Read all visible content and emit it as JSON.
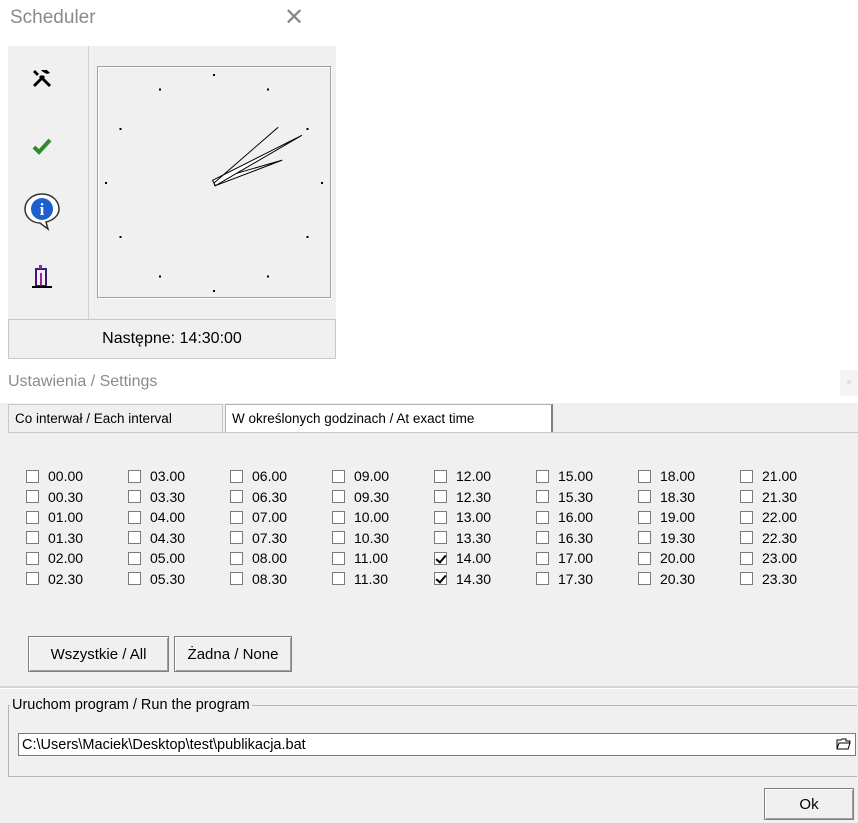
{
  "scheduler": {
    "title": "Scheduler",
    "close_glyph": "✕",
    "toolbar": [
      {
        "name": "settings-tools-icon",
        "glyph": "⚒"
      },
      {
        "name": "checkmark-icon",
        "glyph": "✔"
      },
      {
        "name": "info-icon",
        "glyph": "i"
      },
      {
        "name": "exit-door-icon",
        "glyph": "⍐"
      }
    ],
    "clock": {
      "hour": 2,
      "minute": 7,
      "second": 4
    },
    "status_text": "Następne: 14:30:00"
  },
  "settings": {
    "title": "Ustawienia / Settings",
    "tabs": [
      {
        "label": "Co interwał / Each interval",
        "active": false
      },
      {
        "label": "W określonych godzinach / At exact time",
        "active": true
      }
    ],
    "times": [
      [
        "00.00",
        "00.30",
        "01.00",
        "01.30",
        "02.00",
        "02.30"
      ],
      [
        "03.00",
        "03.30",
        "04.00",
        "04.30",
        "05.00",
        "05.30"
      ],
      [
        "06.00",
        "06.30",
        "07.00",
        "07.30",
        "08.00",
        "08.30"
      ],
      [
        "09.00",
        "09.30",
        "10.00",
        "10.30",
        "11.00",
        "11.30"
      ],
      [
        "12.00",
        "12.30",
        "13.00",
        "13.30",
        "14.00",
        "14.30"
      ],
      [
        "15.00",
        "15.30",
        "16.00",
        "16.30",
        "17.00",
        "17.30"
      ],
      [
        "18.00",
        "18.30",
        "19.00",
        "19.30",
        "20.00",
        "20.30"
      ],
      [
        "21.00",
        "21.30",
        "22.00",
        "22.30",
        "23.00",
        "23.30"
      ]
    ],
    "checked": [
      "14.00",
      "14.30"
    ],
    "buttons": {
      "all": "Wszystkie / All",
      "none": "Żadna / None"
    },
    "run_group_label": "Uruchom program / Run the program",
    "program_path": "C:\\Users\\Maciek\\Desktop\\test\\publikacja.bat",
    "ok_label": "Ok"
  }
}
